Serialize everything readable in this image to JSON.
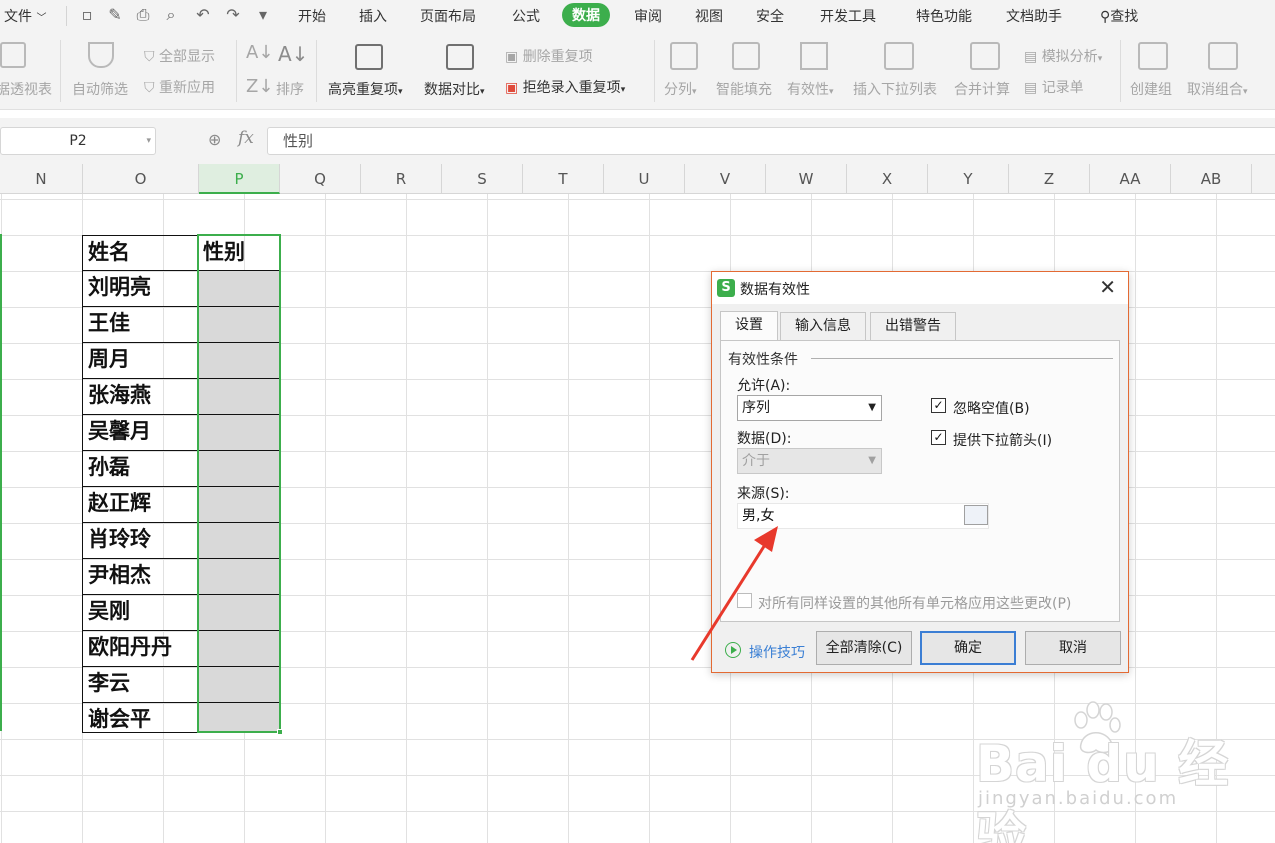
{
  "menubar": {
    "file_label": "文件",
    "tabs": [
      "开始",
      "插入",
      "页面布局",
      "公式",
      "数据",
      "审阅",
      "视图",
      "安全",
      "开发工具",
      "特色功能",
      "文档助手"
    ],
    "active_tab": "数据",
    "search_label": "查找"
  },
  "ribbon": {
    "pivot_label": "数据透视表",
    "autofilter_label": "自动筛选",
    "show_all_label": "全部显示",
    "reapply_label": "重新应用",
    "sort_label": "排序",
    "highlight_dup_label": "高亮重复项",
    "data_compare_label": "数据对比",
    "delete_dup_label": "删除重复项",
    "reject_dup_label": "拒绝录入重复项",
    "split_label": "分列",
    "smart_fill_label": "智能填充",
    "validity_label": "有效性",
    "insert_dropdown_label": "插入下拉列表",
    "merge_calc_label": "合并计算",
    "simulate_label": "模拟分析",
    "record_label": "记录单",
    "create_group_label": "创建组",
    "cancel_group_label": "取消组合"
  },
  "formula_bar": {
    "cell_ref": "P2",
    "fx": "fx",
    "content": "性别"
  },
  "columns": [
    "N",
    "O",
    "P",
    "Q",
    "R",
    "S",
    "T",
    "U",
    "V",
    "W",
    "X",
    "Y",
    "Z",
    "AA",
    "AB"
  ],
  "selected_column": "P",
  "table": {
    "header_name": "姓名",
    "header_gender": "性别",
    "names": [
      "刘明亮",
      "王佳",
      "周月",
      "张海燕",
      "吴馨月",
      "孙磊",
      "赵正辉",
      "肖玲玲",
      "尹相杰",
      "吴刚",
      "欧阳丹丹",
      "李云",
      "谢会平"
    ]
  },
  "dialog": {
    "title": "数据有效性",
    "tabs": [
      "设置",
      "输入信息",
      "出错警告"
    ],
    "active_tab": "设置",
    "group_title": "有效性条件",
    "allow_label": "允许(A):",
    "allow_value": "序列",
    "data_label": "数据(D):",
    "data_value": "介于",
    "ignore_blank_label": "忽略空值(B)",
    "ignore_blank_checked": true,
    "dropdown_arrow_label": "提供下拉箭头(I)",
    "dropdown_arrow_checked": true,
    "source_label": "来源(S):",
    "source_value": "男,女",
    "apply_all_label": "对所有同样设置的其他所有单元格应用这些更改(P)",
    "apply_all_checked": false,
    "tips_label": "操作技巧",
    "clear_all_label": "全部清除(C)",
    "ok_label": "确定",
    "cancel_label": "取消",
    "close_glyph": "✕"
  },
  "watermark": {
    "brand": "Bai du 经验",
    "url": "jingyan.baidu.com"
  },
  "colors": {
    "accent": "#3cae4c",
    "dialog_border": "#e36a33",
    "arrow": "#e8392c",
    "link": "#3a7fd4"
  }
}
